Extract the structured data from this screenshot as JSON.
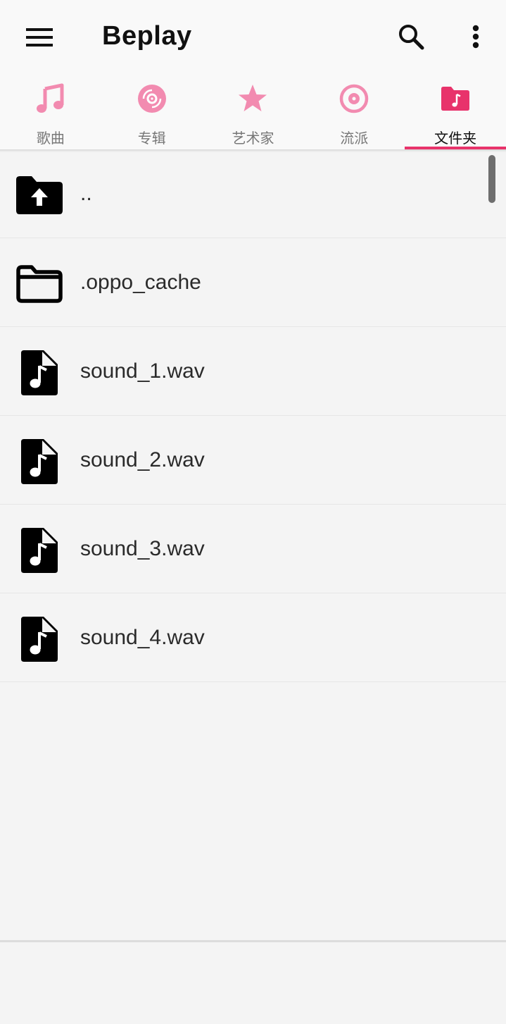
{
  "app": {
    "title": "Beplay",
    "accent_color": "#e8336b",
    "tab_icon_color": "#f28bb0",
    "menu_icon": "menu-icon",
    "search_icon": "search-icon",
    "more_icon": "more-vert-icon"
  },
  "tabs": [
    {
      "label": "歌曲",
      "icon": "music-note-icon",
      "active": false
    },
    {
      "label": "专辑",
      "icon": "album-disc-icon",
      "active": false
    },
    {
      "label": "艺术家",
      "icon": "star-icon",
      "active": false
    },
    {
      "label": "流派",
      "icon": "genre-disc-icon",
      "active": false
    },
    {
      "label": "文件夹",
      "icon": "music-folder-icon",
      "active": true
    }
  ],
  "files": [
    {
      "name": "..",
      "icon": "folder-upload-icon"
    },
    {
      "name": ".oppo_cache",
      "icon": "folder-icon"
    },
    {
      "name": "sound_1.wav",
      "icon": "audio-file-icon"
    },
    {
      "name": "sound_2.wav",
      "icon": "audio-file-icon"
    },
    {
      "name": "sound_3.wav",
      "icon": "audio-file-icon"
    },
    {
      "name": "sound_4.wav",
      "icon": "audio-file-icon"
    }
  ]
}
